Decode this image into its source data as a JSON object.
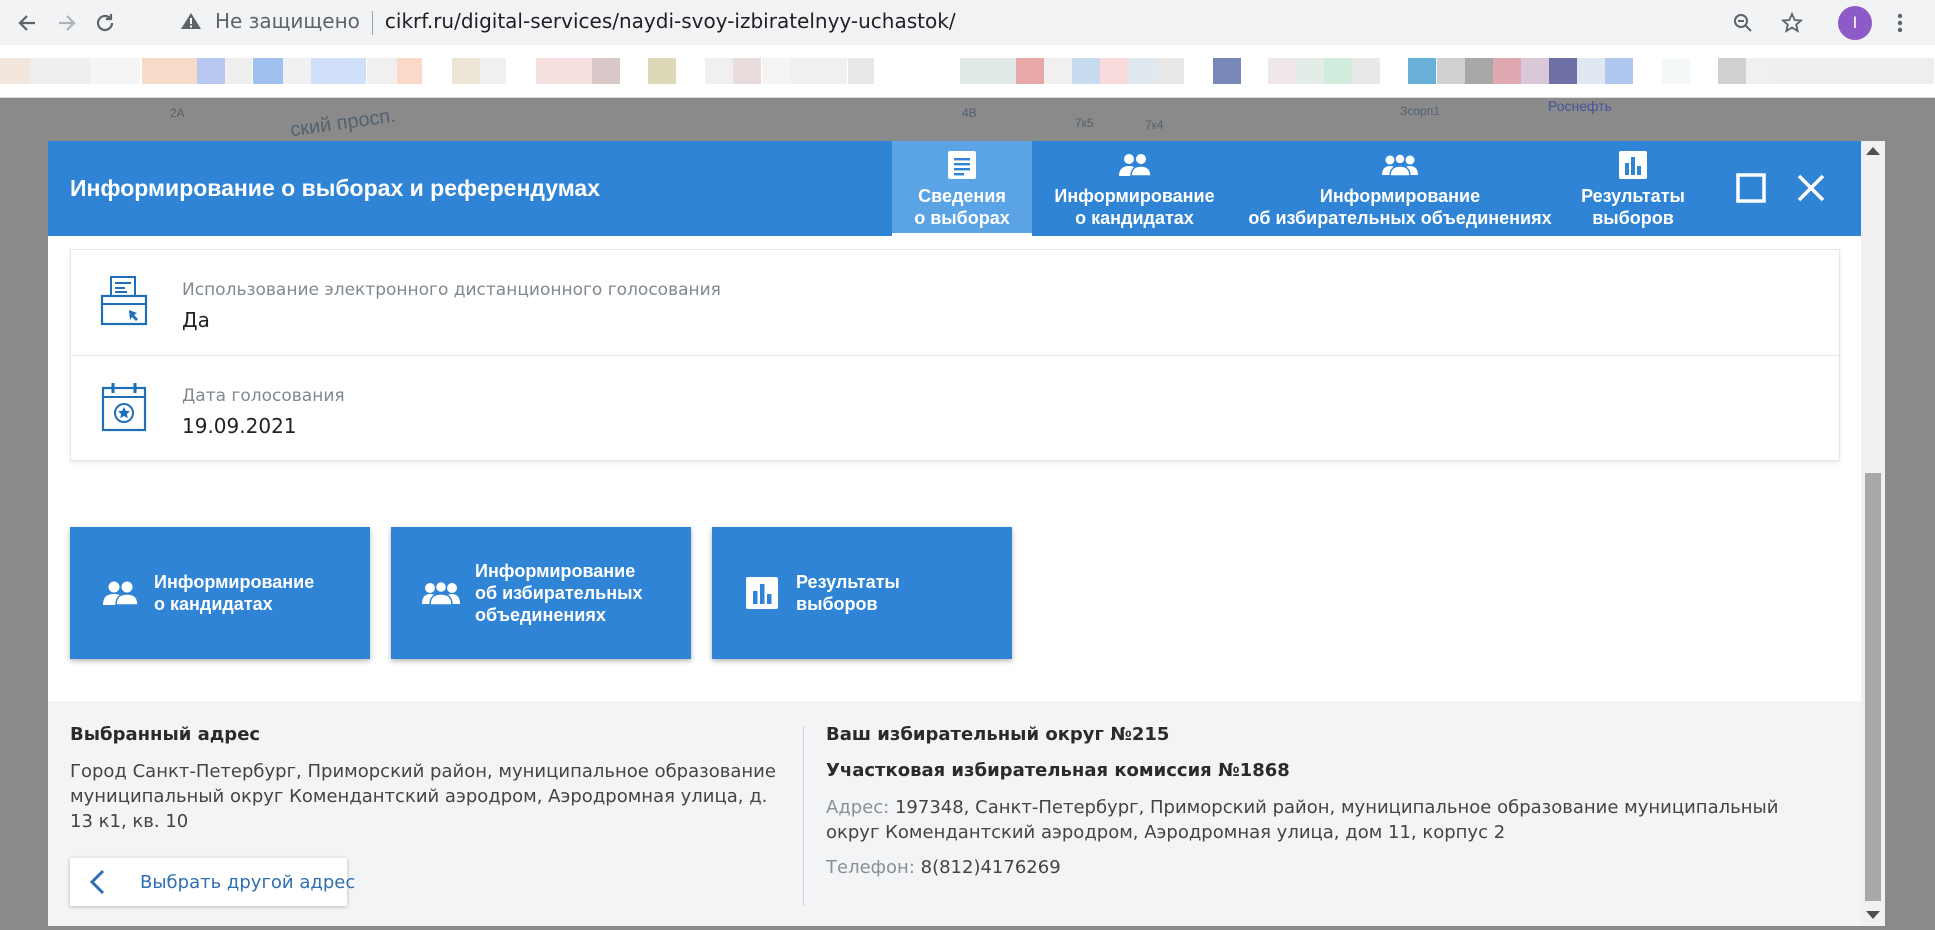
{
  "browser": {
    "security_label": "Не защищено",
    "url": "cikrf.ru/digital-services/naydi-svoy-izbiratelnyy-uchastok/",
    "avatar_letter": "I"
  },
  "map": {
    "labels": [
      "ский просп.",
      "Роснефть",
      "Зсорп1",
      "7к5",
      "7к4",
      "4В",
      "2А"
    ]
  },
  "modal": {
    "title": "Информирование о выборах и референдумах",
    "tabs": [
      {
        "label": "Сведения\nо выборах",
        "icon": "document-icon",
        "active": true
      },
      {
        "label": "Информирование\nо кандидатах",
        "icon": "people-icon",
        "active": false
      },
      {
        "label": "Информирование\nоб избирательных объединениях",
        "icon": "group-icon",
        "active": false
      },
      {
        "label": "Результаты\nвыборов",
        "icon": "chart-icon",
        "active": false
      }
    ],
    "info": [
      {
        "label": "Использование электронного дистанционного голосования",
        "value": "Да",
        "icon": "ballot-box-icon"
      },
      {
        "label": "Дата голосования",
        "value": "19.09.2021",
        "icon": "calendar-icon"
      }
    ],
    "actions": [
      {
        "label": "Информирование\nо кандидатах",
        "icon": "people-icon"
      },
      {
        "label": "Информирование\nоб избирательных\nобъединениях",
        "icon": "group-icon"
      },
      {
        "label": "Результаты\nвыборов",
        "icon": "chart-icon"
      }
    ],
    "address": {
      "title": "Выбранный адрес",
      "text": "Город Санкт-Петербург, Приморский район, муниципальное образование муниципальный округ Комендантский аэродром, Аэродромная улица, д. 13 к1, кв. 10",
      "back_button": "Выбрать другой адрес"
    },
    "district": {
      "title": "Ваш избирательный округ №215",
      "commission": "Участковая избирательная комиссия №1868",
      "address_label": "Адрес:",
      "address_value": "197348, Санкт-Петербург, Приморский район, муниципальное образование муниципальный округ Комендантский аэродром, Аэродромная улица, дом 11, корпус 2",
      "phone_label": "Телефон:",
      "phone_value": "8(812)4176269"
    }
  },
  "colors": {
    "primary": "#2f84d6",
    "active_tab": "#5aa4e6",
    "icon_blue": "#1f6fb8"
  }
}
